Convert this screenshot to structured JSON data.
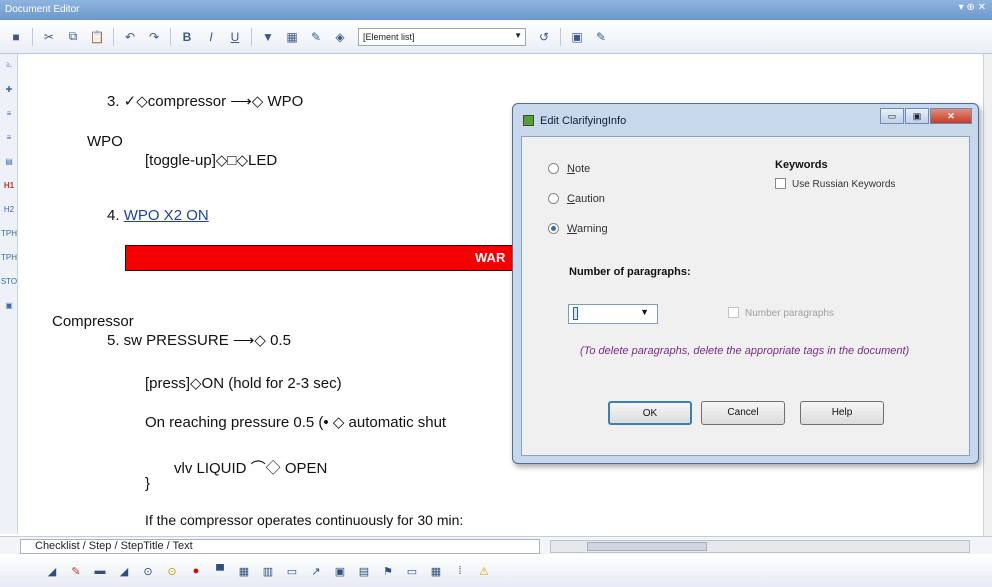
{
  "window": {
    "title": "Document Editor",
    "controls": "▾ ⊕ ✕"
  },
  "toolbar": {
    "buttons": [
      "save",
      "cut",
      "copy",
      "paste",
      "undo",
      "redo",
      "bold",
      "italic",
      "underline",
      "spell",
      "table",
      "link",
      "image"
    ],
    "element_list_value": "[Element list]",
    "button_labels": {
      "save": "■",
      "cut": "✂",
      "copy": "⧉",
      "paste": "📋",
      "undo": "↶",
      "redo": "↷",
      "bold": "B",
      "italic": "I",
      "underline": "U",
      "highlight": "▼",
      "table": "▦",
      "pencil": "✎",
      "tag": "◈",
      "help": "↺",
      "doc": "▣",
      "mark": "✎"
    }
  },
  "left_strip": {
    "icons": [
      "underline-tool",
      "add",
      "indent",
      "outdent",
      "list",
      "h1",
      "h2",
      "tph",
      "tph2",
      "sto",
      "view"
    ],
    "labels": [
      "⎁",
      "✚",
      "≡",
      "≡",
      "▤",
      "H1",
      "H2",
      "TPH",
      "TPH",
      "STO",
      "▣"
    ]
  },
  "document": {
    "lines": [
      {
        "text": "3. ✓◇compressor ⟶◇ WPO"
      },
      {
        "text": "WPO"
      },
      {
        "text": "[toggle-up]◇□◇LED"
      },
      {
        "text": "4. ",
        "link": "WPO X2 ON"
      },
      {
        "text": "Compressor"
      },
      {
        "text": "5. sw PRESSURE ⟶◇ 0.5"
      },
      {
        "text": "[press]◇ON (hold for 2-3 sec)"
      },
      {
        "text": "On reaching pressure 0.5 (• ◇ automatic shut"
      },
      {
        "text": "vlv LIQUID ⌒◇ OPEN"
      },
      {
        "text": "}"
      },
      {
        "text": "If the compressor operates continuously for 30 min:"
      }
    ],
    "warning_text": "WAR"
  },
  "status": {
    "path": "Checklist / Step / StepTitle / Text"
  },
  "dialog": {
    "title": "Edit ClarifyingInfo",
    "controls": {
      "minimize": "▭",
      "maximize": "▣",
      "close": "✕"
    },
    "options": [
      {
        "label_first": "N",
        "label_rest": "ote",
        "selected": false
      },
      {
        "label_first": "C",
        "label_rest": "aution",
        "selected": false
      },
      {
        "label_first": "W",
        "label_rest": "arning",
        "selected": true
      }
    ],
    "keywords_heading": "Keywords",
    "use_russian_keywords": "Use Russian Keywords",
    "number_of_paragraphs_label": "Number of paragraphs:",
    "number_of_paragraphs_value": "",
    "number_paragraphs": "Number paragraphs",
    "hint": "(To delete paragraphs, delete the appropriate tags in the document)",
    "buttons": {
      "ok": "OK",
      "cancel": "Cancel",
      "help": "Help"
    }
  },
  "bottom_toolbar": {
    "labels": [
      "◢",
      "✎",
      "▬",
      "◢",
      "⊙",
      "⊙",
      "●",
      "▀",
      "▦",
      "▥",
      "▭",
      "↗",
      "▣",
      "▤",
      "⚑",
      "▭",
      "▦",
      "⁞",
      "⚠"
    ]
  },
  "colors": {
    "warning_bar": "#f50000",
    "link": "#1f3fa6",
    "hint": "#7a2a8a",
    "title_bar": "#6d97cc"
  }
}
